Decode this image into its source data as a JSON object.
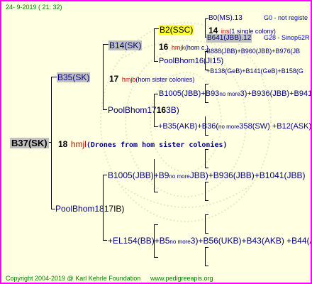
{
  "timestamp": "24-  9-2019 (  21: 32)",
  "root": {
    "label": "B37(SK)",
    "num": "18",
    "mark": "hmjl",
    "note": "(Drones from hom sister colonies)"
  },
  "gen1": {
    "upper": {
      "label": "B35(SK)",
      "num": "17",
      "mark": "hmjb",
      "note": "(hom sister colonies)"
    },
    "lower": {
      "label": "PoolBhom18",
      "suffix": "17IB)"
    }
  },
  "gen2": {
    "b14": {
      "label": "B14(SK)",
      "num": "16",
      "mark": "hmjk",
      "note": "(hom c.)"
    },
    "pool17": {
      "label": "PoolBhom17",
      "suffix": "16",
      "suffix2": "3B)"
    },
    "b1005": {
      "label": "B1005(JBB)+B9",
      "tiny": "no more",
      "rest": "JBB)+B936(JBB)+B1041(JBB)"
    },
    "el154": {
      "label": "+EL154(BB)+B5",
      "tiny": "no more",
      "rest": "3)+B56(UKB)+B43(AKB) +B44(A"
    }
  },
  "gen3": {
    "b2": {
      "label": "B2(SSC)"
    },
    "pool16": {
      "label": "PoolBhom16(JI15)"
    },
    "b1005": {
      "label": "B1005(JBB)+B93",
      "tiny": "no more",
      "rest": "3)+B936(JBB)+B941B"
    },
    "b35": {
      "label": "+B35(AKB)+B36(",
      "tiny": "no more",
      "rest": "358(SW) +B12(ASK)"
    }
  },
  "gen4": {
    "b0": {
      "label": "B0(MS).13",
      "note": "G0 - not registe"
    },
    "line14": {
      "num": "14",
      "mark": "ins",
      "note": "(1 single colony)"
    },
    "b641": {
      "label": "B641(JBB).12",
      "note": "G28 - Sinop62R"
    },
    "b888": {
      "label": "B888(JBB)+B960(JBB)+B976(JB"
    },
    "b138": {
      "label": "+B138(GeB)+B141(GeB)+B158(G"
    }
  },
  "footer": {
    "copyright": "Copyright 2004-2019 @ Karl Kehrle Foundation",
    "website": "www.pedigreeapis.org"
  },
  "colors": {
    "border": "#ff00ff",
    "background": "#ffffe1",
    "mark": "#cc0000",
    "node_text": "#000080",
    "footer_text": "#008000",
    "highlight": "#c0c0c0",
    "queen_mark": "#ffff33"
  }
}
